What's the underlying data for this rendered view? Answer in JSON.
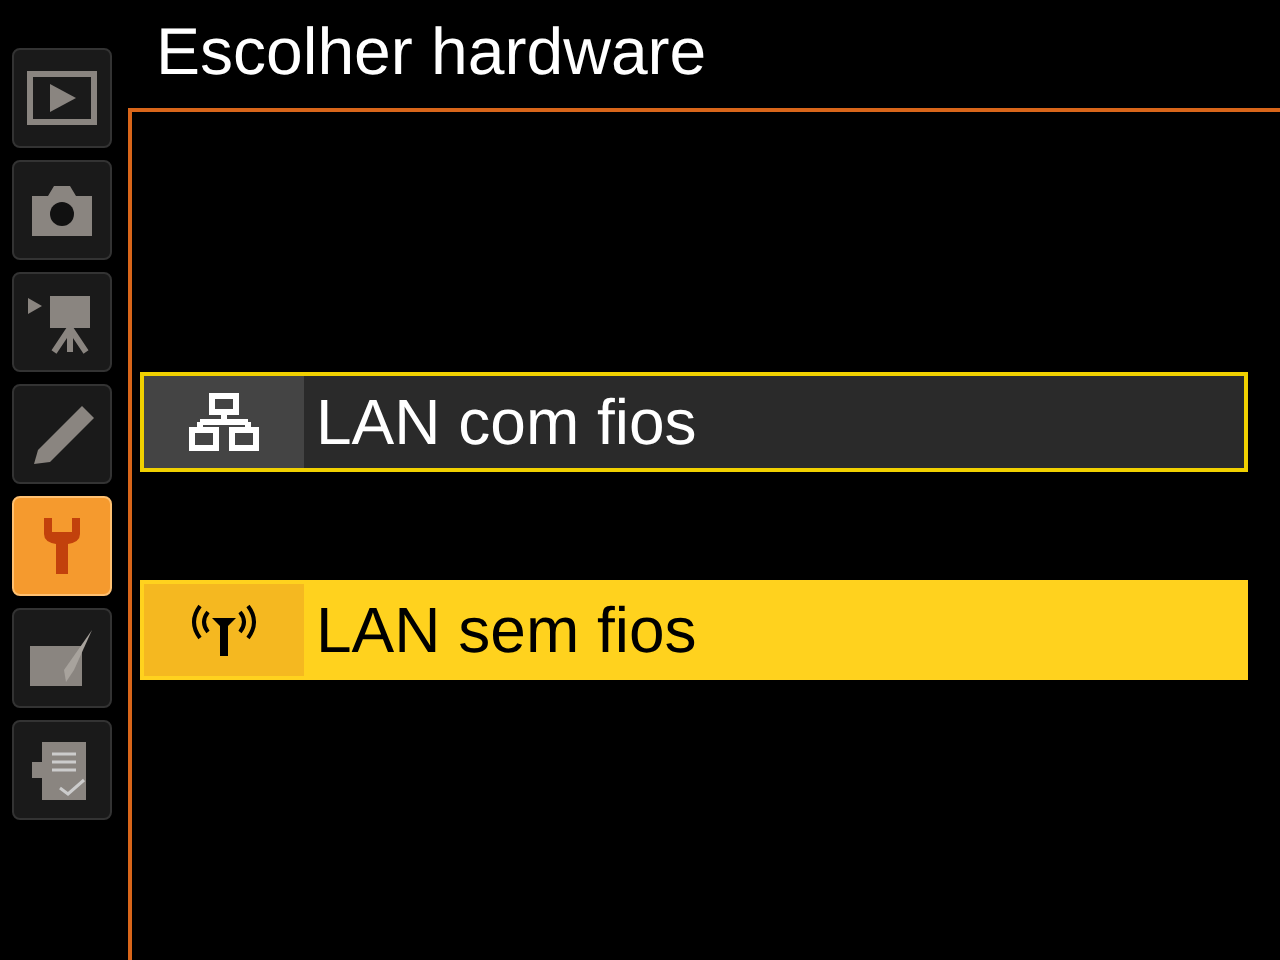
{
  "title": "Escolher hardware",
  "tabs": [
    {
      "kind": "playback",
      "selected": false
    },
    {
      "kind": "camera",
      "selected": false
    },
    {
      "kind": "movie",
      "selected": false
    },
    {
      "kind": "retouch",
      "selected": false
    },
    {
      "kind": "setup",
      "selected": true
    },
    {
      "kind": "custom",
      "selected": false
    },
    {
      "kind": "recent",
      "selected": false
    }
  ],
  "options": [
    {
      "kind": "wired",
      "label": "LAN com fios",
      "current": true,
      "selected": false
    },
    {
      "kind": "wireless",
      "label": "LAN sem fios",
      "current": false,
      "selected": true
    }
  ]
}
